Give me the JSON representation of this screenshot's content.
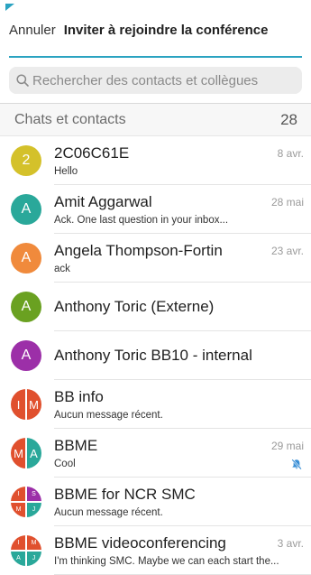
{
  "header": {
    "cancel_label": "Annuler",
    "title": "Inviter à rejoindre la conférence",
    "accent_color": "#2aa3c1"
  },
  "search": {
    "placeholder": "Rechercher des contacts et collègues",
    "icon": "search-icon"
  },
  "section": {
    "title": "Chats et contacts",
    "count": "28"
  },
  "contacts": [
    {
      "name": "2C06C61E",
      "message": "Hello",
      "date": "8 avr.",
      "avatar": {
        "type": "single",
        "initial": "2",
        "color": "#d4c12a"
      }
    },
    {
      "name": "Amit Aggarwal",
      "message": "Ack.  One last question in your inbox...",
      "date": "28 mai",
      "avatar": {
        "type": "single",
        "initial": "A",
        "color": "#2aa89a"
      }
    },
    {
      "name": "Angela Thompson-Fortin",
      "message": "ack",
      "date": "23 avr.",
      "avatar": {
        "type": "single",
        "initial": "A",
        "color": "#f08a3c"
      }
    },
    {
      "name": "Anthony Toric (Externe)",
      "message": "",
      "date": "",
      "avatar": {
        "type": "single",
        "initial": "A",
        "color": "#6aa121"
      }
    },
    {
      "name": "Anthony Toric BB10 - internal",
      "message": "",
      "date": "",
      "avatar": {
        "type": "single",
        "initial": "A",
        "color": "#9c2fa8"
      }
    },
    {
      "name": "BB info",
      "message": "Aucun message récent.",
      "date": "",
      "avatar": {
        "type": "split",
        "left": "I",
        "right": "M",
        "left_color": "#e0502e",
        "right_color": "#e0502e"
      }
    },
    {
      "name": "BBME",
      "message": "Cool",
      "date": "29 mai",
      "muted": true,
      "avatar": {
        "type": "split",
        "left": "M",
        "right": "A",
        "left_color": "#e0502e",
        "right_color": "#2aa89a"
      }
    },
    {
      "name": "BBME for NCR SMC",
      "message": "Aucun message récent.",
      "date": "",
      "avatar": {
        "type": "quad",
        "tl": "I",
        "tr": "S",
        "bl": "M",
        "br": "J",
        "tl_color": "#e0502e",
        "tr_color": "#9c2fa8",
        "bl_color": "#e0502e",
        "br_color": "#2aa89a"
      }
    },
    {
      "name": "BBME videoconferencing",
      "message": "I'm thinking SMC. Maybe we can each start the...",
      "date": "3 avr.",
      "avatar": {
        "type": "quad",
        "tl": "I",
        "tr": "M",
        "bl": "A",
        "br": "J",
        "tl_color": "#e0502e",
        "tr_color": "#e0502e",
        "bl_color": "#2aa89a",
        "br_color": "#2aa89a"
      }
    }
  ]
}
